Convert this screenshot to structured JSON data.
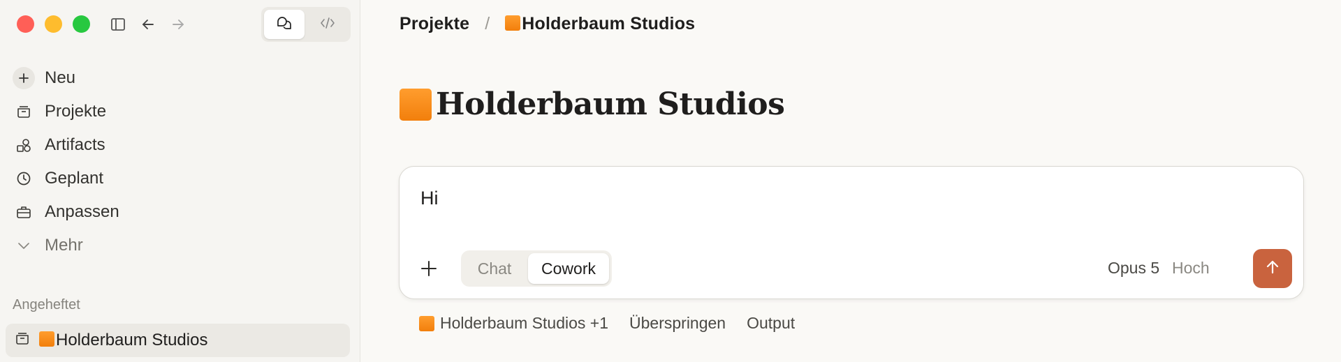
{
  "window": {
    "sidebar_toggle_icon": "sidebar-icon",
    "back_icon": "arrow-left-icon",
    "forward_icon": "arrow-right-icon",
    "modes": [
      {
        "icon": "chat-bubbles-icon",
        "active": true
      },
      {
        "icon": "code-icon",
        "active": false
      }
    ]
  },
  "sidebar": {
    "items": [
      {
        "label": "Neu",
        "icon": "plus-icon"
      },
      {
        "label": "Projekte",
        "icon": "folder-icon"
      },
      {
        "label": "Artifacts",
        "icon": "shapes-icon"
      },
      {
        "label": "Geplant",
        "icon": "clock-icon"
      },
      {
        "label": "Anpassen",
        "icon": "briefcase-icon"
      },
      {
        "label": "Mehr",
        "icon": "chevron-down-icon"
      }
    ],
    "pinned_label": "Angeheftet",
    "pinned_items": [
      {
        "label": "Holderbaum Studios",
        "icon": "folder-icon",
        "emoji": "orange-square"
      }
    ]
  },
  "breadcrumb": {
    "parent": "Projekte",
    "separator": "/",
    "current": "Holderbaum Studios"
  },
  "page": {
    "title": "Holderbaum Studios"
  },
  "composer": {
    "value": "Hi",
    "modes": [
      "Chat",
      "Cowork"
    ],
    "selected_mode": "Cowork",
    "model": "Opus 5",
    "effort": "Hoch",
    "send_icon": "arrow-up-icon",
    "send_color": "#c9633e"
  },
  "chips": {
    "project": "Holderbaum Studios +1",
    "skip": "Überspringen",
    "output": "Output"
  },
  "colors": {
    "accent": "#c9633e",
    "project_square": "#f7870f"
  }
}
